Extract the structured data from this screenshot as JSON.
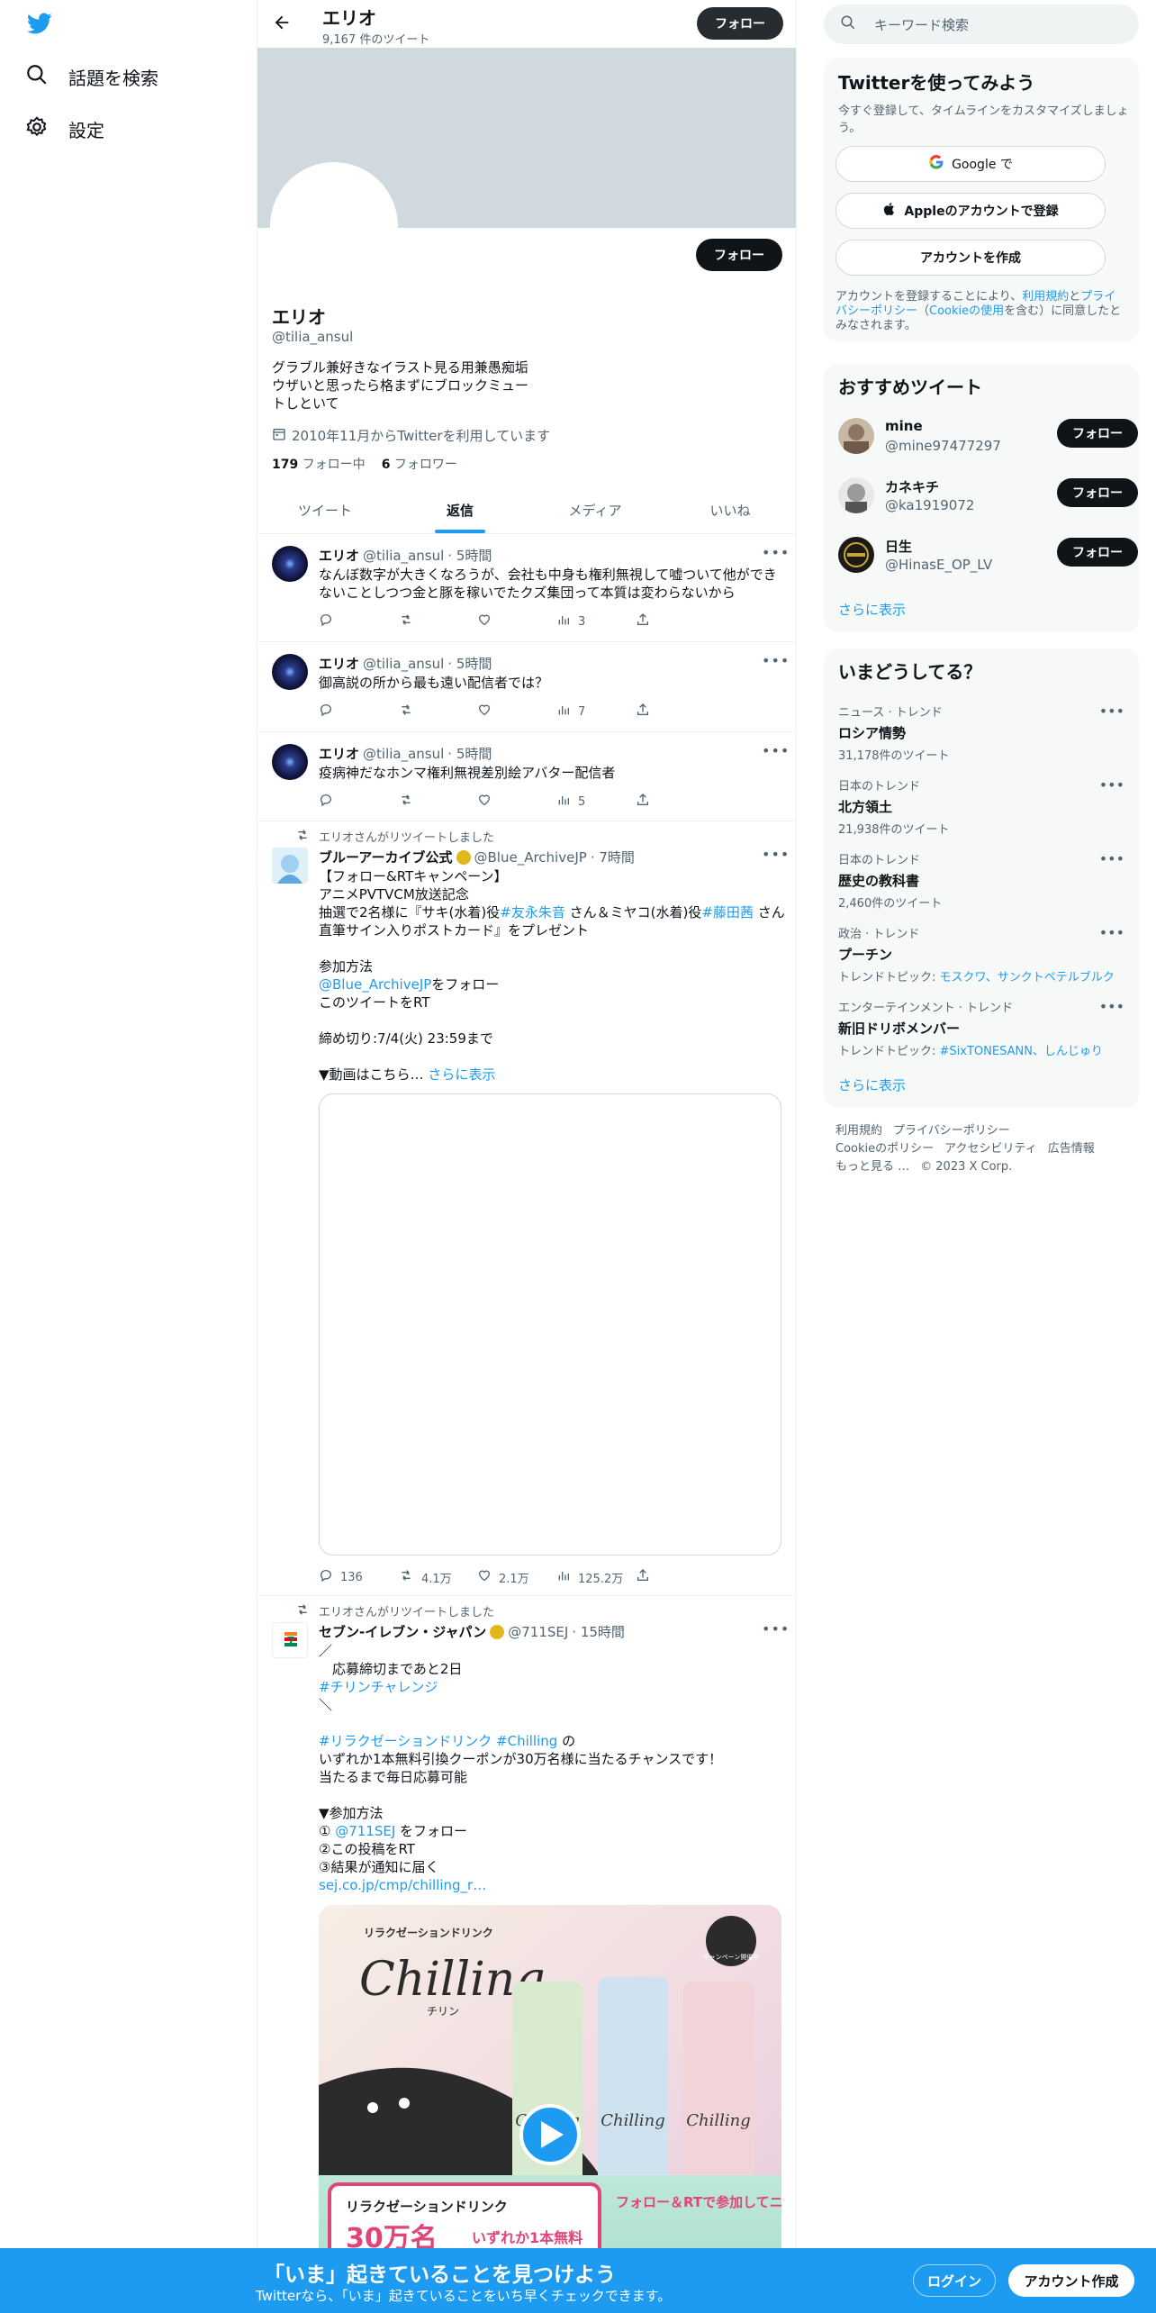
{
  "nav": {
    "search_label": "話題を検索",
    "settings_label": "設定"
  },
  "header": {
    "title": "エリオ",
    "tweet_count": "9,167 件のツイート",
    "follow_label": "フォロー"
  },
  "profile": {
    "follow_label": "フォロー",
    "name": "エリオ",
    "handle": "@tilia_ansul",
    "bio": "グラブル兼好きなイラスト見る用兼愚痴垢\nウザいと思ったら格まずにブロックミュー\nトしといて",
    "joined": "2010年11月からTwitterを利用しています",
    "following_count": "179",
    "following_label": "フォロー中",
    "followers_count": "6",
    "followers_label": "フォロワー"
  },
  "tabs": [
    "ツイート",
    "返信",
    "メディア",
    "いいね"
  ],
  "tweets": [
    {
      "name": "エリオ",
      "handle": "@tilia_ansul",
      "time": "· 5時間",
      "text": "なんぼ数字が大きくなろうが、会社も中身も権利無視して嘘ついて他ができないことしつつ金と豚を稼いでたクズ集団って本質は変わらないから",
      "views": "3"
    },
    {
      "name": "エリオ",
      "handle": "@tilia_ansul",
      "time": "· 5時間",
      "text": "御高説の所から最も遠い配信者では？",
      "views": "7"
    },
    {
      "name": "エリオ",
      "handle": "@tilia_ansul",
      "time": "· 5時間",
      "text": "疫病神だなホンマ権利無視差別絵アバター配信者",
      "views": "5"
    }
  ],
  "retweet1": {
    "rt_label": "エリオさんがリツイートしました",
    "name": "ブルーアーカイブ公式",
    "handle": "@Blue_ArchiveJP",
    "time": "· 7時間",
    "line1": "【フォロー&RTキャンペーン】",
    "line2": "アニメPVTVCM放送記念",
    "line3a": "抽選で2名様に『サキ(水着)役",
    "tag1": "#友永朱音",
    "line3b": "さん＆ミヤコ(水着)役",
    "tag2": "#藤田茜",
    "line3c": "さん",
    "line4": "直筆サイン入りポストカード』をプレゼント",
    "line5": "参加方法",
    "mention": "@Blue_ArchiveJP",
    "line6": "をフォロー",
    "line7": "このツイートをRT",
    "line8": "締め切り:7/4(火) 23:59まで",
    "line9": "▼動画はこちら…",
    "show_more": "さらに表示",
    "replies": "136",
    "retweets": "4.1万",
    "likes": "2.1万",
    "views": "125.2万"
  },
  "retweet2": {
    "rt_label": "エリオさんがリツイートしました",
    "name": "セブン‐イレブン・ジャパン",
    "handle": "@711SEJ",
    "time": "· 15時間",
    "l1": "／",
    "l2": "　応募締切まであと2日",
    "l3": "#チリンチャレンジ",
    "l4": "＼",
    "l5a": "#リラクゼーションドリンク #Chilling",
    "l5b": " の",
    "l6": "いずれか1本無料引換クーポンが30万名様に当たるチャンスです！",
    "l7": "当たるまで毎日応募可能",
    "l8": "▼参加方法",
    "l9a": "① ",
    "l9b": "@711SEJ",
    "l9c": " をフォロー",
    "l10": "②この投稿をRT",
    "l11": "③結果が通知に届く",
    "l12": "sej.co.jp/cmp/chilling_r…",
    "img_title": "リラクゼーションドリンク",
    "img_brand": "Chilling",
    "img_brand_ruby": "チリン",
    "img_badge": "キャンペーン開催中",
    "img_bottom_left_title": "リラクゼーションドリンク",
    "img_bottom_left_count": "30万名",
    "img_bottom_left_prize": "いずれか1本無料",
    "img_bottom_right": "フォロー＆RTで参加してニャ!"
  },
  "right": {
    "search_placeholder": "キーワード検索",
    "signup_title": "Twitterを使ってみよう",
    "signup_sub": "今すぐ登録して、タイムラインをカスタマイズしましょう。",
    "google_btn": "Google で",
    "apple_btn": "Appleのアカウントで登録",
    "create_btn": "アカウントを作成",
    "legal_a": "アカウントを登録することにより、",
    "legal_terms": "利用規約",
    "legal_and": "と",
    "legal_privacy": "プライバシーポリシー",
    "legal_paren1": "（",
    "legal_cookie": "Cookieの使用",
    "legal_b": "を含む）に同意したとみなされます。",
    "rec_title": "おすすめツイート",
    "recs": [
      {
        "name": "mine",
        "handle": "@mine97477297",
        "btn": "フォロー"
      },
      {
        "name": "カネキチ",
        "handle": "@ka1919072",
        "btn": "フォロー"
      },
      {
        "name": "日生",
        "handle": "@HinasE_OP_LV",
        "btn": "フォロー"
      }
    ],
    "show_more": "さらに表示",
    "trends_title": "いまどうしてる？",
    "trends": [
      {
        "category": "ニュース · トレンド",
        "name": "ロシア情勢",
        "meta": "31,178件のツイート"
      },
      {
        "category": "日本のトレンド",
        "name": "北方領土",
        "meta": "21,938件のツイート"
      },
      {
        "category": "日本のトレンド",
        "name": "歴史の教科書",
        "meta": "2,460件のツイート"
      },
      {
        "category": "政治 · トレンド",
        "name": "プーチン",
        "meta_a": "トレンドトピック: ",
        "meta_b": "モスクワ、サンクトペテルブルク"
      },
      {
        "category": "エンターテインメント · トレンド",
        "name": "新旧ドリボメンバー",
        "meta_a": "トレンドトピック: ",
        "meta_b": "#SixTONESANN、しんじゅり"
      }
    ],
    "trends_more": "さらに表示",
    "footer": [
      "利用規約",
      "プライバシーポリシー",
      "Cookieのポリシー",
      "アクセシビリティ",
      "広告情報",
      "もっと見る …",
      "© 2023 X Corp."
    ]
  },
  "bottom": {
    "title": "「いま」起きていることを見つけよう",
    "sub": "Twitterなら、「いま」起きていることをいち早くチェックできます。",
    "login": "ログイン",
    "signup": "アカウント作成"
  },
  "colors": {
    "accent": "#1d9bf0",
    "text": "#0f1419",
    "muted": "#536471",
    "banner": "#cfd9de"
  }
}
